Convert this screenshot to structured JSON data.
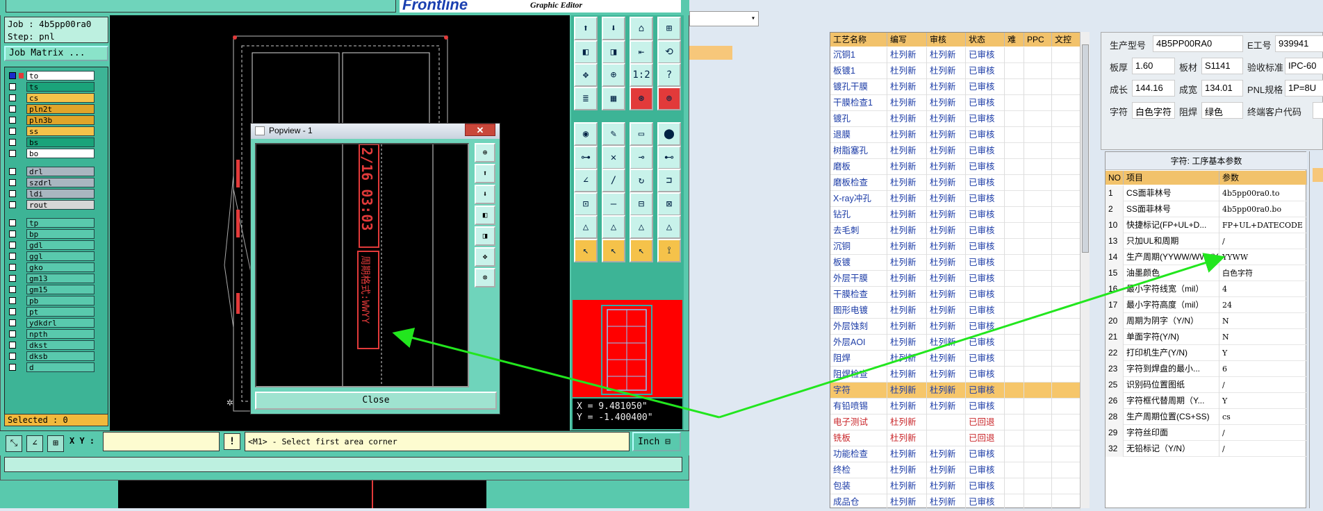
{
  "genesis": {
    "brand": "Frontline",
    "brand_sub": "Graphic Editor",
    "job_line": "Job : 4b5pp00ra0",
    "step_line": "Step: pnl",
    "job_matrix_label": "Job Matrix ...",
    "selected_label": "Selected : 0",
    "coords": {
      "x": "X = 9.481050\"",
      "y": "Y = -1.400400\""
    },
    "xy_label": "X Y :",
    "prompt": "<M1> - Select first area corner",
    "units": "Inch",
    "layers_group1": [
      {
        "name": "to",
        "color": "#ffffff",
        "checked": true
      },
      {
        "name": "ts",
        "color": "#1aa37a"
      },
      {
        "name": "cs",
        "color": "#f5c24a"
      },
      {
        "name": "pln2t",
        "color": "#e0a52a"
      },
      {
        "name": "pln3b",
        "color": "#e0a52a"
      },
      {
        "name": "ss",
        "color": "#f5c24a"
      },
      {
        "name": "bs",
        "color": "#1aa37a"
      },
      {
        "name": "bo",
        "color": "#ffffff"
      }
    ],
    "layers_group2": [
      {
        "name": "drl",
        "color": "#a9b6c0"
      },
      {
        "name": "szdrl",
        "color": "#a9b6c0"
      },
      {
        "name": "ldi",
        "color": "#a9b6c0"
      },
      {
        "name": "rout",
        "color": "#d6d6d6"
      }
    ],
    "layers_group3": [
      {
        "name": "tp"
      },
      {
        "name": "bp"
      },
      {
        "name": "gdl"
      },
      {
        "name": "ggl"
      },
      {
        "name": "gko"
      },
      {
        "name": "gm13"
      },
      {
        "name": "gm15"
      },
      {
        "name": "pb"
      },
      {
        "name": "pt"
      },
      {
        "name": "ydkdrl"
      },
      {
        "name": "npth"
      },
      {
        "name": "dkst"
      },
      {
        "name": "dksb"
      },
      {
        "name": "d"
      }
    ],
    "layer_group3_color": "#59c9ad"
  },
  "popview": {
    "title": "Popview - 1",
    "close_label": "Close",
    "datecode_text": "2/16 03:03",
    "marking_text": "周期格式:WWYY"
  },
  "process_table": {
    "headers": [
      "工艺名称",
      "编写",
      "审核",
      "状态",
      "难",
      "PPC",
      "文控"
    ],
    "rows": [
      {
        "name": "沉铜1",
        "writer": "杜列新",
        "reviewer": "杜列新",
        "status": "已审核"
      },
      {
        "name": "板镀1",
        "writer": "杜列新",
        "reviewer": "杜列新",
        "status": "已审核"
      },
      {
        "name": "镀孔干膜",
        "writer": "杜列新",
        "reviewer": "杜列新",
        "status": "已审核"
      },
      {
        "name": "干膜检查1",
        "writer": "杜列新",
        "reviewer": "杜列新",
        "status": "已审核"
      },
      {
        "name": "镀孔",
        "writer": "杜列新",
        "reviewer": "杜列新",
        "status": "已审核"
      },
      {
        "name": "退膜",
        "writer": "杜列新",
        "reviewer": "杜列新",
        "status": "已审核"
      },
      {
        "name": "树脂塞孔",
        "writer": "杜列新",
        "reviewer": "杜列新",
        "status": "已审核"
      },
      {
        "name": "磨板",
        "writer": "杜列新",
        "reviewer": "杜列新",
        "status": "已审核"
      },
      {
        "name": "磨板检查",
        "writer": "杜列新",
        "reviewer": "杜列新",
        "status": "已审核"
      },
      {
        "name": "X-ray冲孔",
        "writer": "杜列新",
        "reviewer": "杜列新",
        "status": "已审核"
      },
      {
        "name": "钻孔",
        "writer": "杜列新",
        "reviewer": "杜列新",
        "status": "已审核"
      },
      {
        "name": "去毛刺",
        "writer": "杜列新",
        "reviewer": "杜列新",
        "status": "已审核"
      },
      {
        "name": "沉铜",
        "writer": "杜列新",
        "reviewer": "杜列新",
        "status": "已审核"
      },
      {
        "name": "板镀",
        "writer": "杜列新",
        "reviewer": "杜列新",
        "status": "已审核"
      },
      {
        "name": "外层干膜",
        "writer": "杜列新",
        "reviewer": "杜列新",
        "status": "已审核"
      },
      {
        "name": "干膜检查",
        "writer": "杜列新",
        "reviewer": "杜列新",
        "status": "已审核"
      },
      {
        "name": "图形电镀",
        "writer": "杜列新",
        "reviewer": "杜列新",
        "status": "已审核"
      },
      {
        "name": "外层蚀刻",
        "writer": "杜列新",
        "reviewer": "杜列新",
        "status": "已审核"
      },
      {
        "name": "外层AOI",
        "writer": "杜列新",
        "reviewer": "杜列新",
        "status": "已审核"
      },
      {
        "name": "阻焊",
        "writer": "杜列新",
        "reviewer": "杜列新",
        "status": "已审核"
      },
      {
        "name": "阻焊检查",
        "writer": "杜列新",
        "reviewer": "杜列新",
        "status": "已审核"
      },
      {
        "name": "字符",
        "writer": "杜列新",
        "reviewer": "杜列新",
        "status": "已审核",
        "highlight": true
      },
      {
        "name": "有铅喷锡",
        "writer": "杜列新",
        "reviewer": "杜列新",
        "status": "已审核"
      },
      {
        "name": "电子测试",
        "writer": "杜列新",
        "reviewer": "",
        "status": "已回退",
        "red": true
      },
      {
        "name": "铣板",
        "writer": "杜列新",
        "reviewer": "",
        "status": "已回退",
        "red": true
      },
      {
        "name": "功能检查",
        "writer": "杜列新",
        "reviewer": "杜列新",
        "status": "已审核"
      },
      {
        "name": "终检",
        "writer": "杜列新",
        "reviewer": "杜列新",
        "status": "已审核"
      },
      {
        "name": "包装",
        "writer": "杜列新",
        "reviewer": "杜列新",
        "status": "已审核"
      },
      {
        "name": "成品仓",
        "writer": "杜列新",
        "reviewer": "杜列新",
        "status": "已审核"
      }
    ]
  },
  "info": {
    "model_label": "生产型号",
    "model_value": "4B5PP00RA0",
    "eno_label": "E工号",
    "eno_value": "939941",
    "thickness_label": "板厚",
    "thickness_value": "1.60",
    "material_label": "板材",
    "material_value": "S1141",
    "standard_label": "验收标准",
    "standard_value": "IPC-60",
    "length_label": "成长",
    "length_value": "144.16",
    "width_label": "成宽",
    "width_value": "134.01",
    "pnl_label": "PNL规格",
    "pnl_value": "1P=8U",
    "char_label": "字符",
    "char_value": "白色字符",
    "mask_label": "阻焊",
    "mask_value": "绿色",
    "customer_label": "终端客户代码",
    "customer_value": ""
  },
  "params": {
    "title": "字符: 工序基本参数",
    "headers": [
      "NO",
      "项目",
      "参数"
    ],
    "rows": [
      {
        "no": "1",
        "item": "CS面菲林号",
        "value": "4b5pp00ra0.to"
      },
      {
        "no": "2",
        "item": "SS面菲林号",
        "value": "4b5pp00ra0.bo"
      },
      {
        "no": "10",
        "item": "快捷标记(FP+UL+D...",
        "value": "FP+UL+DATECODE"
      },
      {
        "no": "13",
        "item": "只加UL和周期",
        "value": "/"
      },
      {
        "no": "14",
        "item": "生产周期(YYWW/WWYY)",
        "value": "YYWW"
      },
      {
        "no": "15",
        "item": "油墨颜色",
        "value": "白色字符"
      },
      {
        "no": "16",
        "item": "最小字符线宽（mil）",
        "value": "4"
      },
      {
        "no": "17",
        "item": "最小字符高度（mil）",
        "value": "24"
      },
      {
        "no": "20",
        "item": "周期为阴字（Y/N）",
        "value": "N"
      },
      {
        "no": "21",
        "item": "单面字符(Y/N)",
        "value": "N"
      },
      {
        "no": "22",
        "item": "打印机生产(Y/N)",
        "value": "Y"
      },
      {
        "no": "23",
        "item": "字符到焊盘的最小...",
        "value": "6"
      },
      {
        "no": "25",
        "item": "识别码位置图纸",
        "value": "/"
      },
      {
        "no": "26",
        "item": "字符框代替周期（Y...",
        "value": "Y"
      },
      {
        "no": "28",
        "item": "生产周期位置(CS+SS)",
        "value": "cs"
      },
      {
        "no": "29",
        "item": "字符丝印面",
        "value": "/"
      },
      {
        "no": "32",
        "item": "无铅标记（Y/N）",
        "value": "/"
      }
    ]
  },
  "colors": {
    "arrow": "#22e61e",
    "highlight": "#f6c66a",
    "accent_red": "#ff0000"
  }
}
